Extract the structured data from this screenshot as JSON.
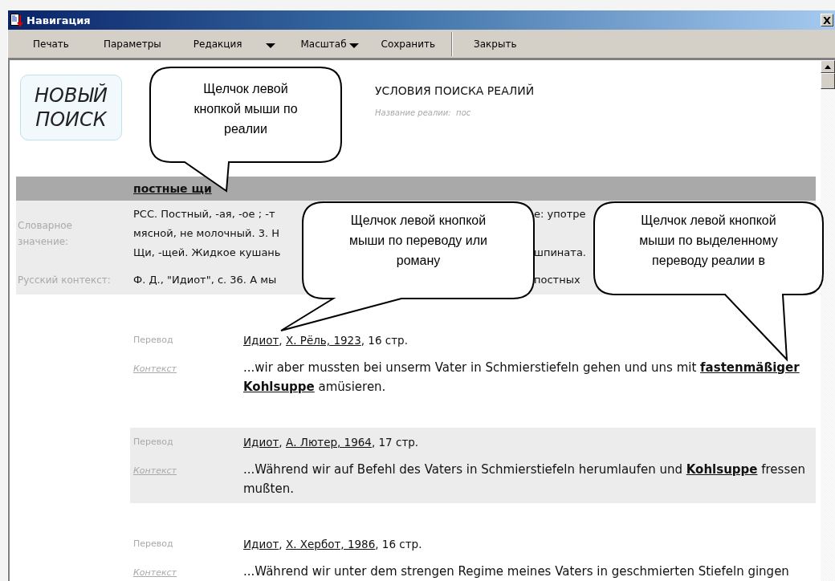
{
  "window": {
    "title": "Навигация",
    "close": "X"
  },
  "toolbar": [
    {
      "kind": "button",
      "label": "Печать"
    },
    {
      "kind": "button",
      "label": "Параметры"
    },
    {
      "kind": "split-menu",
      "label": "Редакция"
    },
    {
      "kind": "menu",
      "label": "Масштаб"
    },
    {
      "kind": "button",
      "label": "Сохранить"
    },
    {
      "kind": "separator"
    },
    {
      "kind": "button",
      "label": "Закрыть"
    }
  ],
  "new_search": "НОВЫЙ ПОИСК",
  "search_conditions": {
    "title": "УСЛОВИЯ ПОИСКА РЕАЛИЙ",
    "label": "Название реалии:",
    "value": "пос"
  },
  "term": "постные щи",
  "dictionary": {
    "label": "Словарное значение:",
    "lines": [
      {
        "left": "РСС. Постный, -ая, -ое ; -т",
        "right": "е: употре"
      },
      {
        "left": "мясной, не молочный. 3. Н"
      },
      {
        "left": "Щи, -щей. Жидкое кушань",
        "right": "шпината."
      }
    ]
  },
  "russian_context": {
    "label": "Русский контекст:",
    "left": "Ф. Д., \"Идиот\", с. 36. А мы",
    "right": "постных"
  },
  "translations": [
    {
      "highlighted": false,
      "label": "Перевод",
      "citation": [
        {
          "text": "Идиот",
          "link": true
        },
        {
          "text": ", ",
          "link": false
        },
        {
          "text": "Х. Рёль, 1923",
          "link": true
        },
        {
          "text": ", 16 стр.",
          "link": false
        }
      ],
      "context_label": "Контекст",
      "context": "...wir aber mussten bei unserm Vater in Schmierstiefeln gehen und uns mit **fastenmäßiger Kohlsuppe** amüsieren."
    },
    {
      "highlighted": true,
      "label": "Перевод",
      "citation": [
        {
          "text": "Идиот",
          "link": true
        },
        {
          "text": ", ",
          "link": false
        },
        {
          "text": "А. Лютер, 1964",
          "link": true
        },
        {
          "text": ", 17 стр.",
          "link": false
        }
      ],
      "context_label": "Контекст",
      "context": "...Während wir auf Befehl des Vaters in Schmierstiefeln herumlaufen und **Kohlsuppe** fressen mußten."
    },
    {
      "highlighted": false,
      "label": "Перевод",
      "citation": [
        {
          "text": "Идиот",
          "link": true
        },
        {
          "text": ", ",
          "link": false
        },
        {
          "text": "Х. Хербот, 1986",
          "link": true
        },
        {
          "text": ", 16 стр.",
          "link": false
        }
      ],
      "context_label": "Контекст",
      "context": "...Während wir unter dem strengen Regime meines Vaters in geschmierten Stiefeln gingen"
    }
  ],
  "callouts": [
    {
      "lines": [
        "Щелчок левой",
        "кнопкой мыши по",
        "реалии"
      ]
    },
    {
      "lines": [
        "Щелчок левой кнопкой",
        "мыши по переводу или",
        "роману"
      ]
    },
    {
      "lines": [
        "Щелчок левой кнопкой",
        "мыши по выделенному",
        "переводу реалии в"
      ]
    }
  ]
}
